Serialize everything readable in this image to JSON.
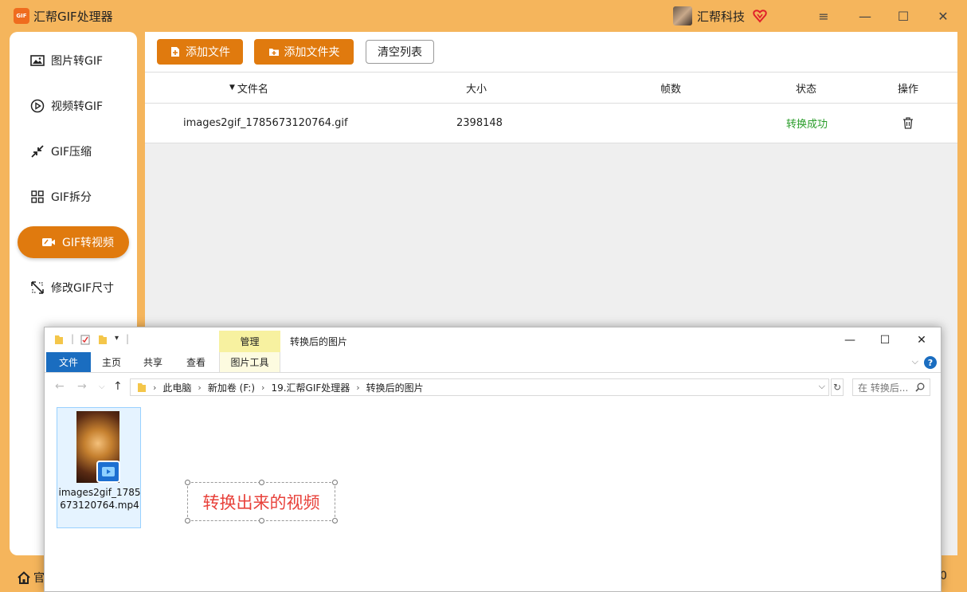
{
  "app": {
    "title": "汇帮GIF处理器",
    "logo_text": "GIF",
    "user_name": "汇帮科技",
    "accent_color": "#e07a0e",
    "bg_color": "#f5b55c"
  },
  "window_controls": {
    "menu": "≡",
    "minimize": "—",
    "maximize": "☐",
    "close": "✕"
  },
  "sidebar": {
    "items": [
      {
        "label": "图片转GIF",
        "icon": "image-icon"
      },
      {
        "label": "视频转GIF",
        "icon": "play-circle-icon"
      },
      {
        "label": "GIF压缩",
        "icon": "compress-icon"
      },
      {
        "label": "GIF拆分",
        "icon": "grid-split-icon"
      },
      {
        "label": "GIF转视频",
        "icon": "video-icon",
        "active": true
      },
      {
        "label": "修改GIF尺寸",
        "icon": "resize-icon"
      }
    ]
  },
  "toolbar": {
    "add_file": "添加文件",
    "add_folder": "添加文件夹",
    "clear_list": "清空列表"
  },
  "table": {
    "headers": {
      "name": "文件名",
      "size": "大小",
      "frames": "帧数",
      "status": "状态",
      "action": "操作"
    },
    "rows": [
      {
        "name": "images2gif_1785673120764.gif",
        "size": "2398148",
        "frames": "",
        "status": "转换成功"
      }
    ]
  },
  "bottom": {
    "home_label": "官",
    "right_fragment": "0"
  },
  "explorer": {
    "context_group": "管理",
    "window_title": "转换后的图片",
    "tabs": {
      "file": "文件",
      "home": "主页",
      "share": "共享",
      "view": "查看",
      "picture_tools": "图片工具"
    },
    "breadcrumb": [
      "此电脑",
      "新加卷 (F:)",
      "19.汇帮GIF处理器",
      "转换后的图片"
    ],
    "search_placeholder": "在 转换后...",
    "help": "?",
    "file": {
      "name": "images2gif_1785673120764.mp4"
    },
    "annotation": "转换出来的视频"
  }
}
